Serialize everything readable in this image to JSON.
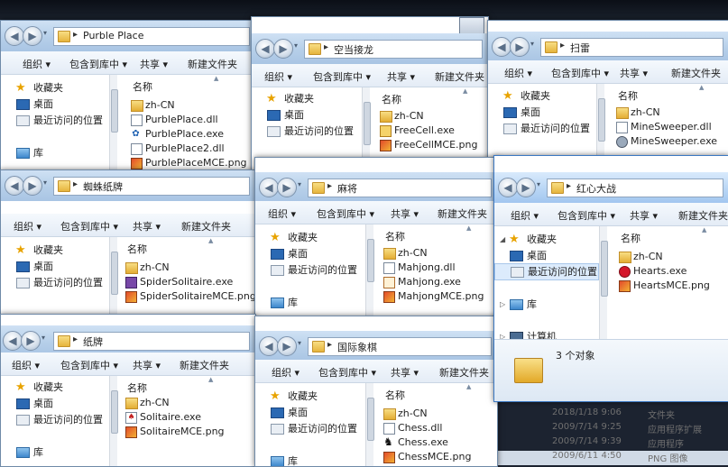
{
  "toolbar": {
    "organize": "组织 ▾",
    "include": "包含到库中 ▾",
    "share": "共享 ▾",
    "new_folder": "新建文件夹"
  },
  "nav": {
    "favorites": "收藏夹",
    "desktop": "桌面",
    "recent": "最近访问的位置",
    "library": "库",
    "computer": "计算机"
  },
  "column_name": "名称",
  "windows": {
    "purble": {
      "path": "Purble Place",
      "files": [
        "zh-CN",
        "PurblePlace.dll",
        "PurblePlace.exe",
        "PurblePlace2.dll",
        "PurblePlaceMCE.png"
      ]
    },
    "freecell": {
      "path": "空当接龙",
      "files": [
        "zh-CN",
        "FreeCell.exe",
        "FreeCellMCE.png"
      ]
    },
    "minesweeper": {
      "path": "扫雷",
      "files": [
        "zh-CN",
        "MineSweeper.dll",
        "MineSweeper.exe"
      ]
    },
    "spider": {
      "path": "蜘蛛纸牌",
      "files": [
        "zh-CN",
        "SpiderSolitaire.exe",
        "SpiderSolitaireMCE.png"
      ]
    },
    "mahjong": {
      "path": "麻将",
      "files": [
        "zh-CN",
        "Mahjong.dll",
        "Mahjong.exe",
        "MahjongMCE.png"
      ]
    },
    "hearts": {
      "path": "红心大战",
      "files": [
        "zh-CN",
        "Hearts.exe",
        "HeartsMCE.png"
      ],
      "status": "3 个对象"
    },
    "solitaire": {
      "path": "纸牌",
      "files": [
        "zh-CN",
        "Solitaire.exe",
        "SolitaireMCE.png"
      ]
    },
    "chess": {
      "path": "国际象棋",
      "files": [
        "zh-CN",
        "Chess.dll",
        "Chess.exe",
        "ChessMCE.png"
      ]
    }
  },
  "chess_details": [
    {
      "date": "2018/1/18 9:06",
      "type": "文件夹"
    },
    {
      "date": "2009/7/14 9:25",
      "type": "应用程序扩展"
    },
    {
      "date": "2009/7/14 9:39",
      "type": "应用程序"
    },
    {
      "date": "2009/6/11 4:50",
      "type": "PNG 图像"
    }
  ]
}
